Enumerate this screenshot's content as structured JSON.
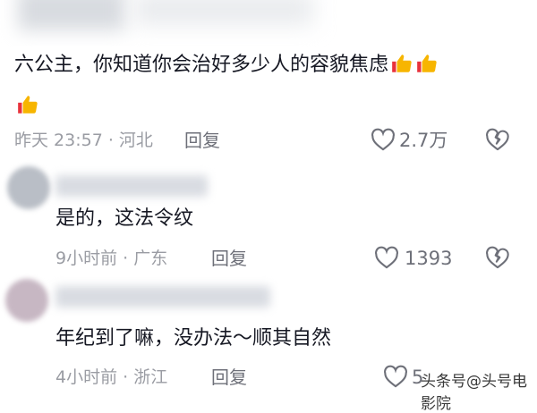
{
  "comments": [
    {
      "text": "六公主，你知道你会治好多少人的容貌焦虑",
      "meta": "昨天 23:57 · 河北",
      "reply_label": "回复",
      "likes": "2.7万"
    },
    {
      "text": "是的，这法令纹",
      "meta": "9小时前 · 广东",
      "reply_label": "回复",
      "likes": "1393"
    },
    {
      "text": "年纪到了嘛，没办法～顺其自然",
      "meta": "4小时前 · 浙江",
      "reply_label": "回复",
      "likes": "5"
    }
  ],
  "emoji": [
    "thumbs-up-icon",
    "thumbs-up-icon",
    "thumbs-up-icon"
  ],
  "watermark": "头条号@头号电影院",
  "colors": {
    "text": "#161823",
    "meta": "#9a9ca3",
    "thumb": "#f7b500"
  }
}
